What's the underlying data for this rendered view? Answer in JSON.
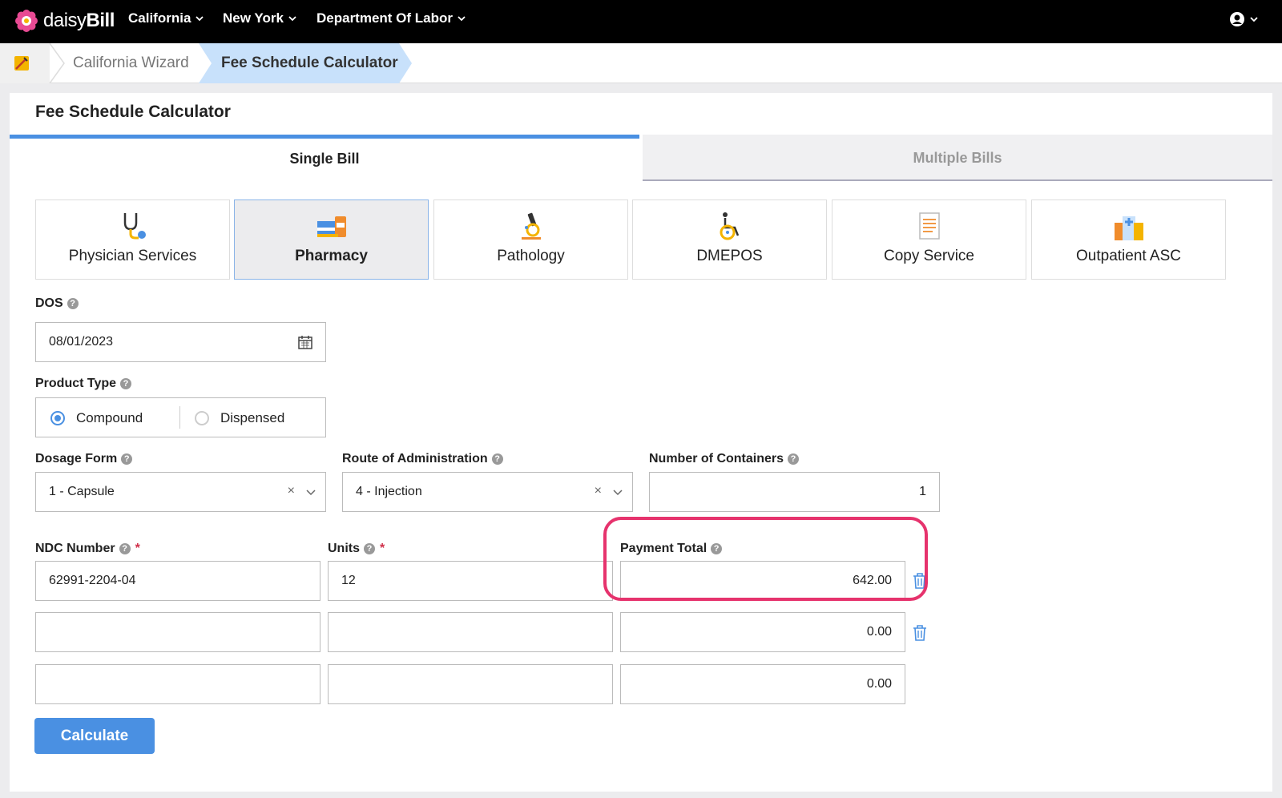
{
  "topnav": {
    "brand_light": "daisy",
    "brand_bold": "Bill",
    "menus": [
      "California",
      "New York",
      "Department Of Labor"
    ]
  },
  "breadcrumb": {
    "wizard": "California Wizard",
    "current": "Fee Schedule Calculator"
  },
  "page": {
    "title": "Fee Schedule Calculator",
    "tabs": {
      "single": "Single Bill",
      "multiple": "Multiple Bills"
    }
  },
  "services": [
    {
      "label": "Physician Services",
      "icon": "stethoscope-icon"
    },
    {
      "label": "Pharmacy",
      "icon": "pharmacy-icon",
      "active": true
    },
    {
      "label": "Pathology",
      "icon": "microscope-icon"
    },
    {
      "label": "DMEPOS",
      "icon": "wheelchair-icon"
    },
    {
      "label": "Copy Service",
      "icon": "document-icon"
    },
    {
      "label": "Outpatient ASC",
      "icon": "hospital-icon"
    }
  ],
  "form": {
    "dos": {
      "label": "DOS",
      "value": "08/01/2023"
    },
    "product_type": {
      "label": "Product Type",
      "options": [
        "Compound",
        "Dispensed"
      ],
      "selected": "Compound"
    },
    "dosage_form": {
      "label": "Dosage Form",
      "value": "1 - Capsule"
    },
    "route": {
      "label": "Route of Administration",
      "value": "4 - Injection"
    },
    "containers": {
      "label": "Number of Containers",
      "value": "1"
    },
    "ndc_label": "NDC Number",
    "units_label": "Units",
    "payment_label": "Payment Total",
    "rows": [
      {
        "ndc": "62991-2204-04",
        "units": "12",
        "payment": "642.00"
      },
      {
        "ndc": "",
        "units": "",
        "payment": "0.00"
      },
      {
        "ndc": "",
        "units": "",
        "payment": "0.00"
      }
    ],
    "calculate": "Calculate"
  },
  "colors": {
    "accent": "#4a90e2",
    "highlight": "#e6336d",
    "required": "#d0304a"
  }
}
